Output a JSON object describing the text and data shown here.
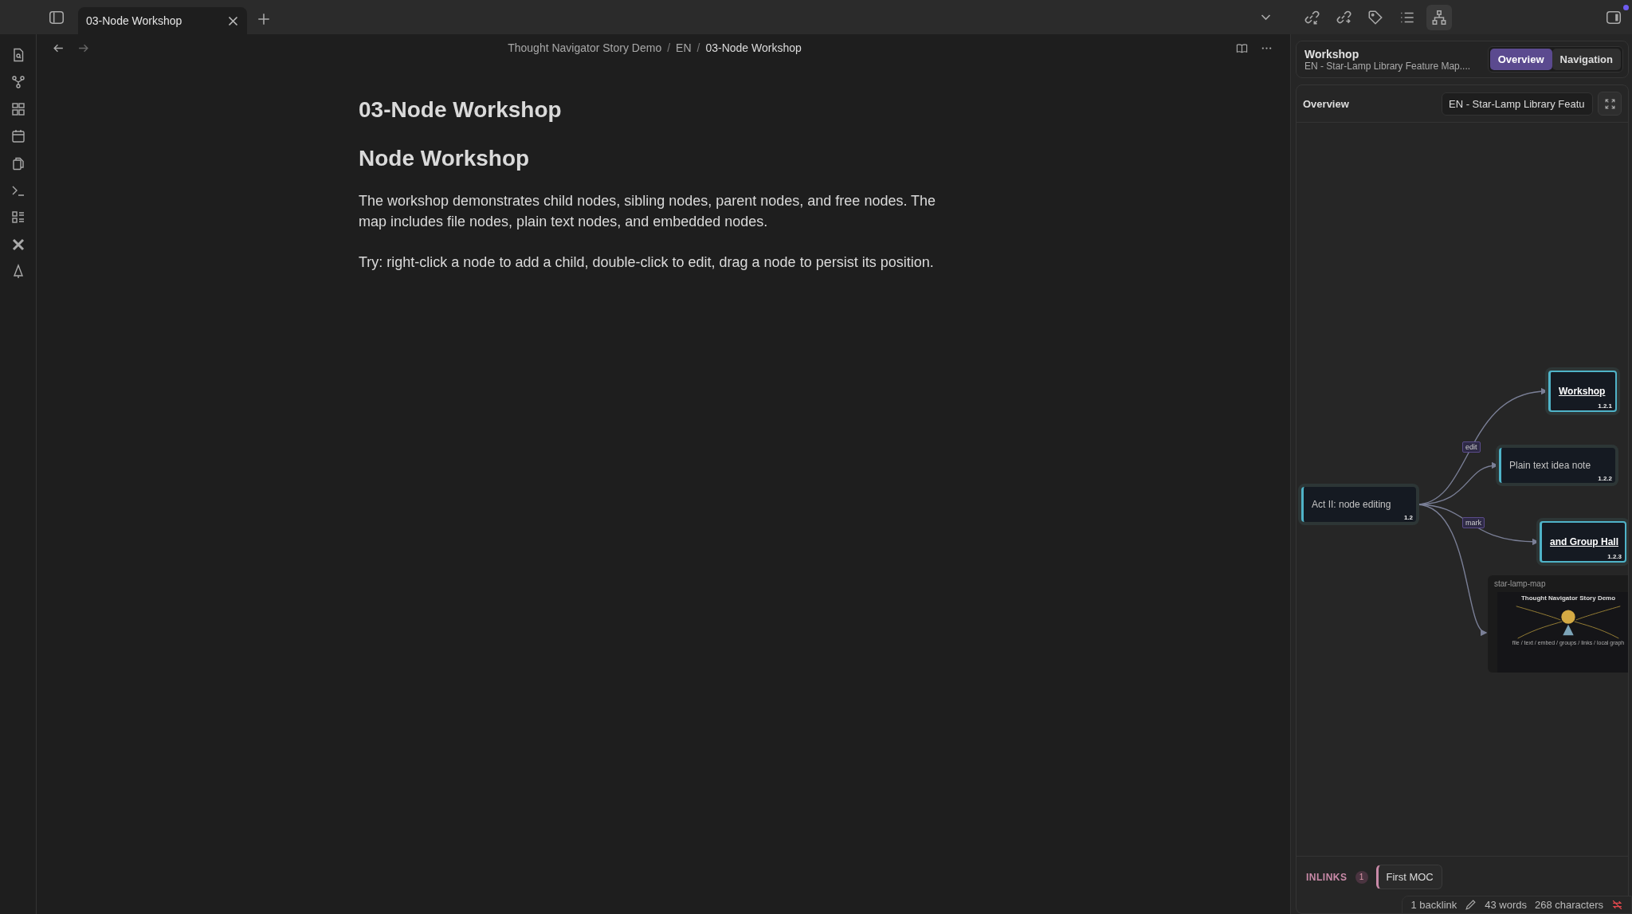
{
  "tabs": [
    {
      "label": "03-Node Workshop",
      "selected": true
    }
  ],
  "right_toolbar": [
    {
      "kind": "link-in",
      "selected": false
    },
    {
      "kind": "link-out",
      "selected": false
    },
    {
      "kind": "tag",
      "selected": false
    },
    {
      "kind": "list",
      "selected": false
    },
    {
      "kind": "hierarchy",
      "selected": true
    }
  ],
  "breadcrumb": [
    {
      "kind": "item",
      "text": "Thought Navigator Story Demo"
    },
    {
      "kind": "separator",
      "text": "/"
    },
    {
      "kind": "item",
      "text": "EN"
    },
    {
      "kind": "separator",
      "text": "/"
    },
    {
      "kind": "current",
      "text": "03-Node Workshop"
    }
  ],
  "note": {
    "title": "03-Node Workshop",
    "heading": "Node Workshop",
    "paragraphs": [
      "The workshop demonstrates child nodes, sibling nodes, parent nodes, and free nodes. The map includes file nodes, plain text nodes, and embedded nodes.",
      "Try: right-click a node to add a child, double-click to edit, drag a node to persist its position."
    ]
  },
  "right_panel": {
    "header": {
      "title": "Workshop",
      "subtitle": "EN - Star-Lamp Library Feature Map....",
      "modes": [
        {
          "label": "Overview",
          "selected": true
        },
        {
          "label": "Navigation",
          "selected": false
        }
      ]
    },
    "overview": {
      "label": "Overview",
      "map_field": "EN - Star-Lamp Library Featu"
    },
    "map": {
      "nodes": [
        {
          "kind": "text",
          "label": "Act II: node editing",
          "number": "1.2"
        },
        {
          "kind": "file",
          "label": "Workshop",
          "number": "1.2.1"
        },
        {
          "kind": "text",
          "label": "Plain text idea note",
          "number": "1.2.2"
        },
        {
          "kind": "file",
          "label": "and Group Hall",
          "number": "1.2.3"
        },
        {
          "kind": "embed",
          "label": "star-lamp-map",
          "embed_title": "Thought Navigator Story Demo",
          "embed_caption": "file / text / embed / groups / links / local graph"
        }
      ],
      "edge_labels": [
        "edit",
        "mark"
      ]
    },
    "inlinks": {
      "label": "INLINKS",
      "count": "1",
      "items": [
        "First MOC"
      ]
    }
  },
  "status_bar": {
    "backlinks": "1 backlink",
    "words": "43 words",
    "characters": "268 characters"
  }
}
